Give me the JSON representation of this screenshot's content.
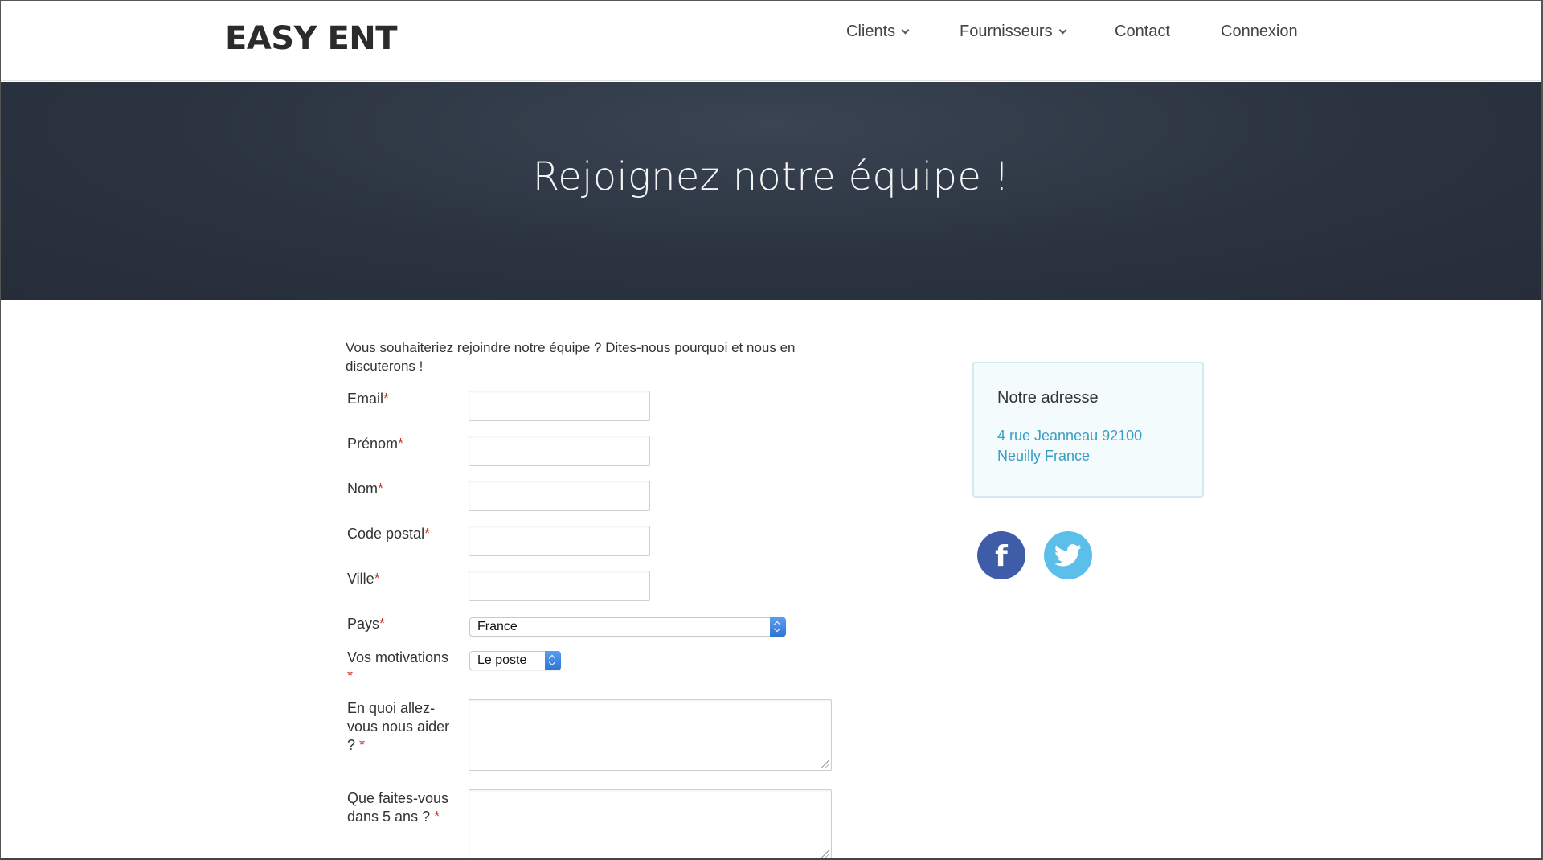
{
  "header": {
    "logo": "EASY ENT",
    "nav": {
      "clients": "Clients",
      "fournisseurs": "Fournisseurs",
      "contact": "Contact",
      "connexion": "Connexion"
    }
  },
  "hero": {
    "title": "Rejoignez notre équipe !"
  },
  "form": {
    "intro": "Vous souhaiteriez rejoindre notre équipe ? Dites-nous pourquoi et nous en discuterons !",
    "required_mark": "*",
    "email_label": "Email",
    "prenom_label": "Prénom",
    "nom_label": "Nom",
    "code_postal_label": "Code postal",
    "ville_label": "Ville",
    "pays_label": "Pays",
    "pays_value": "France",
    "motivations_label": "Vos motivations",
    "motivations_value": "Le poste",
    "aide_label": "En quoi allez-vous nous aider ?",
    "futur_label": "Que faites-vous dans 5 ans ?"
  },
  "address": {
    "title": "Notre adresse",
    "line1": "4 rue Jeanneau 92100",
    "line2": "Neuilly France"
  },
  "social": {
    "facebook_icon": "facebook-icon",
    "twitter_icon": "twitter-icon",
    "facebook_color": "#3f5ca8",
    "twitter_color": "#5cbfe9"
  }
}
